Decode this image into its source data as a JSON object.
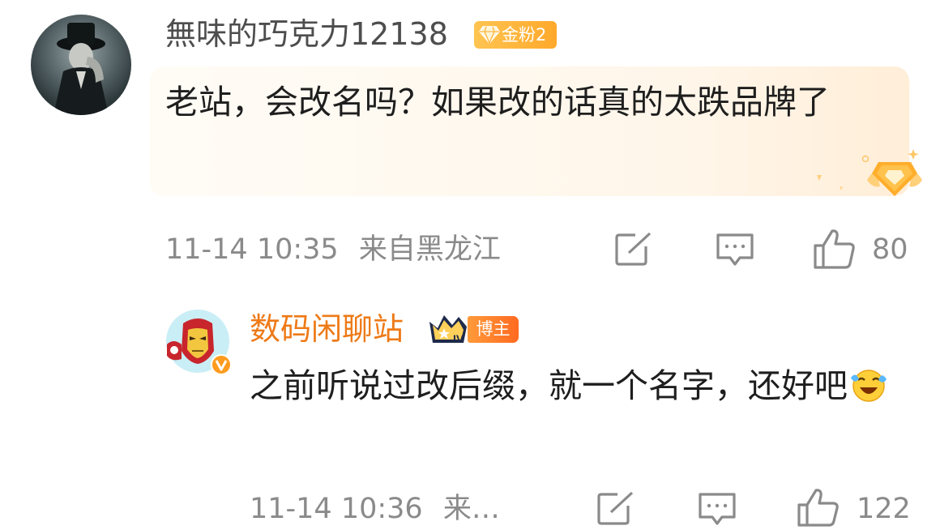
{
  "comment": {
    "username": "無味的巧克力12138",
    "badge": "金粉2",
    "text": "老站，会改名吗？如果改的话真的太跌品牌了",
    "timestamp": "11-14 10:35",
    "location": "来自黑龙江",
    "like_count": "80"
  },
  "reply": {
    "username": "数码闲聊站",
    "crown_level": "IV",
    "badge": "博主",
    "text": "之前听说过改后缀，就一个名字，还好吧",
    "emoji": "laugh-cry-emoji",
    "timestamp": "11-14 10:36",
    "location_truncated": "来…",
    "like_count": "122"
  },
  "icons": {
    "share": "share-icon",
    "comment": "comment-icon",
    "like": "thumbs-up-icon",
    "verified": "verified-v-badge"
  },
  "colors": {
    "username": "#4d4d4d",
    "blogger_name": "#ee7a17",
    "meta": "#8a8a8a",
    "badge_gold": "#ffb23b",
    "badge_blogger": "#ff7a26",
    "bubble": "#fff6ea"
  }
}
